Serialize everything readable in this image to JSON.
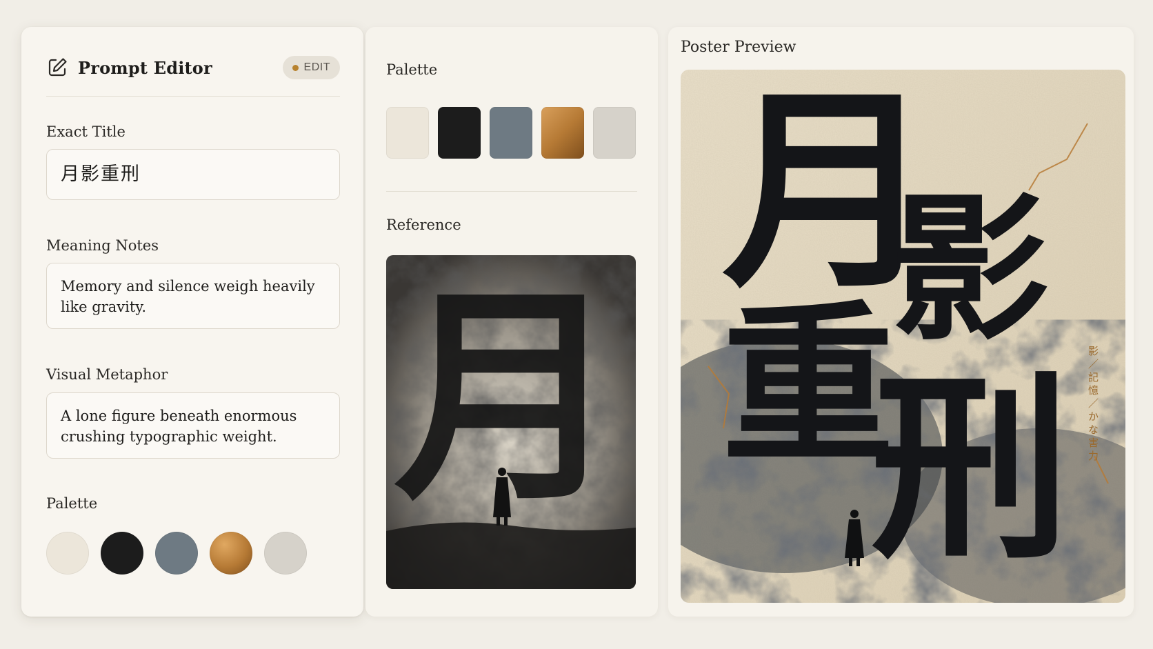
{
  "editor": {
    "title": "Prompt Editor",
    "badge": "EDIT",
    "exact_title_label": "Exact Title",
    "exact_title_value": "月影重刑",
    "meaning_label": "Meaning Notes",
    "meaning_value": "Memory and silence weigh heavily like gravity.",
    "metaphor_label": "Visual Metaphor",
    "metaphor_value": "A lone figure beneath enormous crushing typographic weight.",
    "palette_label": "Palette"
  },
  "middle": {
    "palette_label": "Palette",
    "reference_label": "Reference",
    "reference_glyph": "月"
  },
  "preview": {
    "label": "Poster Preview",
    "glyphs": [
      "月",
      "影",
      "重",
      "刑"
    ],
    "side_text": "影／記憶／かな害力"
  },
  "palette": [
    "#ece6da",
    "#1c1c1c",
    "#6e7a83",
    "#b67a35",
    "#d6d2ca"
  ],
  "accent": "#b8832f"
}
